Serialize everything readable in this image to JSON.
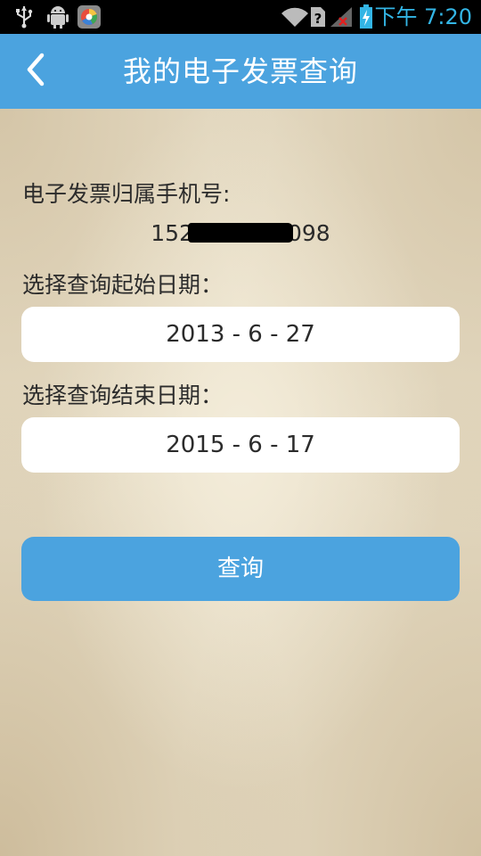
{
  "status_bar": {
    "time": "下午 7:20",
    "icons": [
      "usb-icon",
      "android-debug-icon",
      "app-store-icon",
      "wifi-icon",
      "no-sim-icon",
      "signal-off-icon",
      "battery-charging-icon"
    ]
  },
  "title_bar": {
    "title": "我的电子发票查询",
    "back_icon": "chevron-left-icon"
  },
  "form": {
    "phone_label": "电子发票归属手机号:",
    "phone_prefix": "152",
    "phone_suffix": "098",
    "start_label": "选择查询起始日期：",
    "start_date": "2013 - 6 - 27",
    "end_label": "选择查询结束日期：",
    "end_date": "2015 - 6 - 17",
    "query_button": "查询"
  },
  "colors": {
    "accent": "#4ba3df",
    "status_time": "#33b5e5",
    "background": "#e6dcc5"
  }
}
